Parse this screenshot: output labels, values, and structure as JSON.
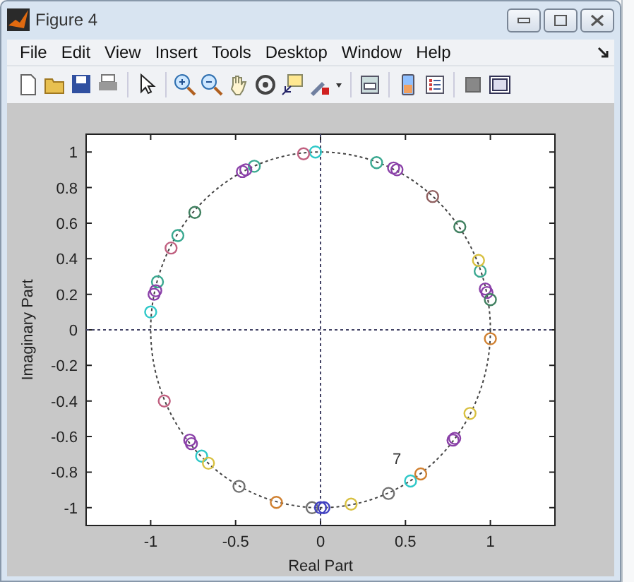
{
  "window": {
    "title": "Figure 4"
  },
  "menu": [
    {
      "label": "File"
    },
    {
      "label": "Edit"
    },
    {
      "label": "View"
    },
    {
      "label": "Insert"
    },
    {
      "label": "Tools"
    },
    {
      "label": "Desktop"
    },
    {
      "label": "Window"
    },
    {
      "label": "Help"
    }
  ],
  "figure": {
    "chart_data": {
      "type": "scatter",
      "xlabel": "Real Part",
      "ylabel": "Imaginary Part",
      "xlim": [
        -1.38,
        1.38
      ],
      "ylim": [
        -1.1,
        1.1
      ],
      "xticks": [
        -1,
        -0.5,
        0,
        0.5,
        1
      ],
      "yticks": [
        {
          "value": -1,
          "label": "-1"
        },
        {
          "value": -0.8,
          "label": "-0.8"
        },
        {
          "value": -0.6,
          "label": "-0.6"
        },
        {
          "value": -0.4,
          "label": "-0.4"
        },
        {
          "value": -0.2,
          "label": "-0.2"
        },
        {
          "value": 0,
          "label": "0"
        },
        {
          "value": 0.2,
          "label": "0.2"
        },
        {
          "value": 0.4,
          "label": "0.4"
        },
        {
          "value": 0.6,
          "label": "0.6"
        },
        {
          "value": 0.8,
          "label": "0.8"
        },
        {
          "value": 1,
          "label": "1"
        }
      ],
      "series": [
        {
          "color": "#2ec8c8",
          "x": [
            -0.03,
            -1.0,
            -0.7,
            0.53
          ],
          "values": [
            1.0,
            0.1,
            -0.71,
            -0.85
          ]
        },
        {
          "color": "#3aa890",
          "x": [
            -0.39,
            -0.84,
            -0.96,
            0.33,
            0.94
          ],
          "values": [
            0.92,
            0.53,
            0.27,
            0.94,
            0.33
          ]
        },
        {
          "color": "#8a40a8",
          "x": [
            -0.44,
            -0.46,
            -0.97,
            -0.98,
            0.43,
            0.45,
            0.97,
            0.98,
            -0.77,
            -0.76,
            0.78,
            0.79
          ],
          "values": [
            0.9,
            0.89,
            0.22,
            0.2,
            0.91,
            0.9,
            0.23,
            0.21,
            -0.62,
            -0.64,
            -0.62,
            -0.61
          ]
        },
        {
          "color": "#c06080",
          "x": [
            -0.1,
            -0.88,
            -0.92
          ],
          "values": [
            0.99,
            0.46,
            -0.4
          ]
        },
        {
          "color": "#906060",
          "x": [
            0.66
          ],
          "values": [
            0.75
          ]
        },
        {
          "color": "#408060",
          "x": [
            -0.74,
            0.82,
            1.0
          ],
          "values": [
            0.66,
            0.58,
            0.17
          ]
        },
        {
          "color": "#d8c040",
          "x": [
            0.93,
            -0.66,
            0.18,
            0.88
          ],
          "values": [
            0.39,
            -0.75,
            -0.98,
            -0.47
          ]
        },
        {
          "color": "#d08030",
          "x": [
            1.0,
            -0.26,
            0.59
          ],
          "values": [
            -0.05,
            -0.97,
            -0.81
          ]
        },
        {
          "color": "#707070",
          "x": [
            -0.48,
            -0.05,
            0.4
          ],
          "values": [
            -0.88,
            -1.0,
            -0.92
          ]
        },
        {
          "color": "#4040c0",
          "x": [
            0.0,
            0.02
          ],
          "values": [
            -1.0,
            -1.0
          ]
        }
      ],
      "annotations": [
        "7"
      ]
    }
  }
}
